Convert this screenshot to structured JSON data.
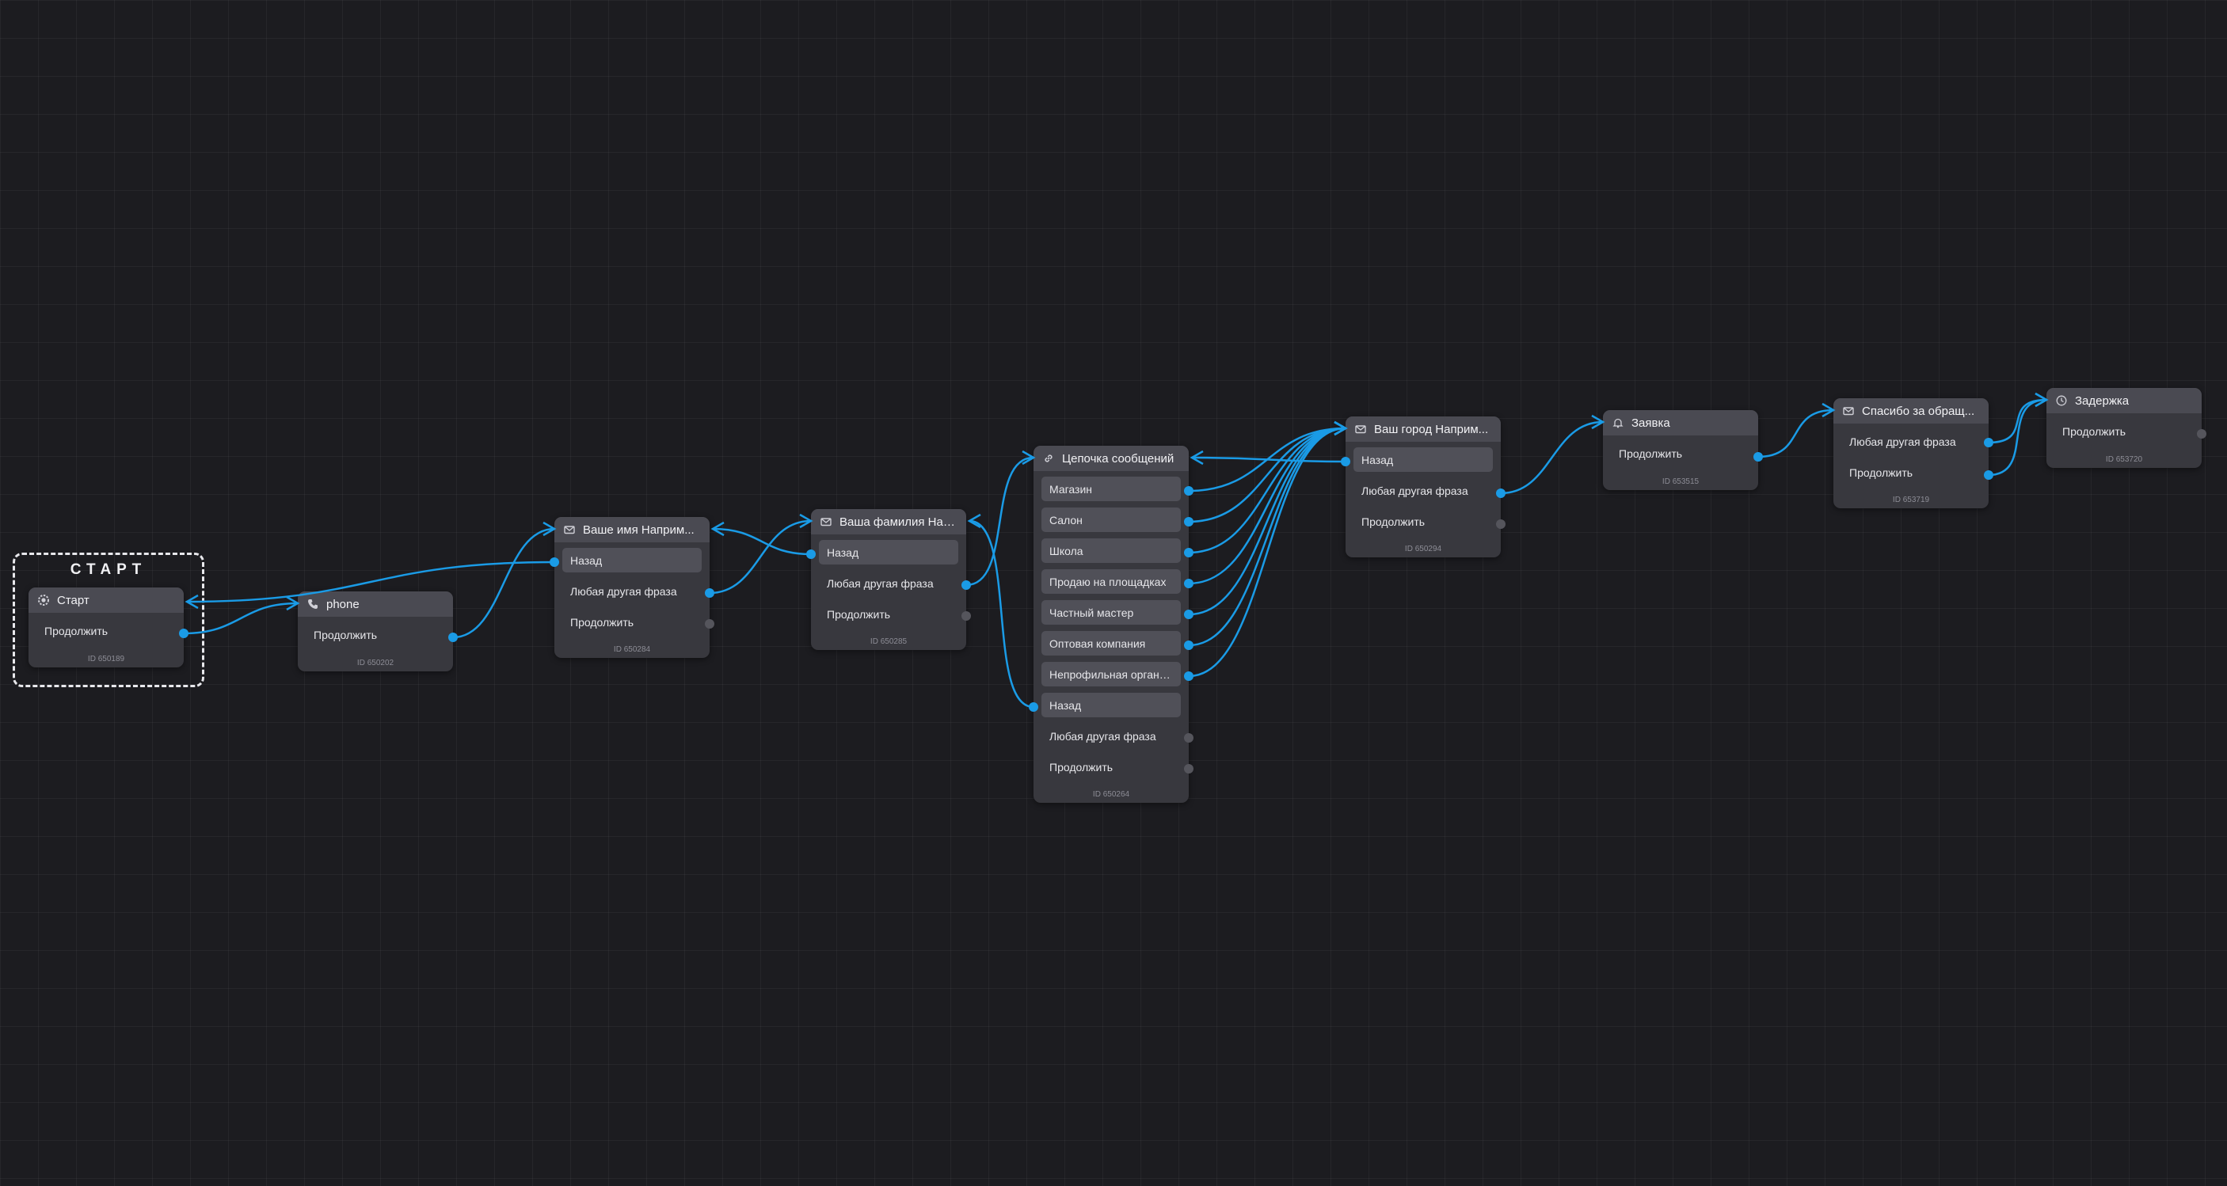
{
  "canvas": {
    "accent_color": "#1a9be6",
    "background_color": "#1c1c20",
    "inactive_port_color": "#55555c"
  },
  "start_block": {
    "label": "СТАРТ"
  },
  "nodes": {
    "start": {
      "title": "Старт",
      "icon": "gear-icon",
      "rows": [
        "Продолжить"
      ],
      "id": "ID 650189"
    },
    "phone": {
      "title": "phone",
      "icon": "phone-icon",
      "rows": [
        "Продолжить"
      ],
      "id": "ID 650202"
    },
    "name": {
      "title": "Ваше имя Наприм...",
      "icon": "envelope-icon",
      "rows": [
        "Назад",
        "Любая другая фраза",
        "Продолжить"
      ],
      "id": "ID 650284"
    },
    "surname": {
      "title": "Ваша фамилия Нап...",
      "icon": "envelope-icon",
      "rows": [
        "Назад",
        "Любая другая фраза",
        "Продолжить"
      ],
      "id": "ID 650285"
    },
    "chain": {
      "title": "Цепочка сообщений",
      "icon": "link-icon",
      "rows": [
        "Магазин",
        "Салон",
        "Школа",
        "Продаю на площадках",
        "Частный мастер",
        "Оптовая компания",
        "Непрофильная организа...",
        "Назад",
        "Любая другая фраза",
        "Продолжить"
      ],
      "id": "ID 650264"
    },
    "city": {
      "title": "Ваш город Наприм...",
      "icon": "envelope-icon",
      "rows": [
        "Назад",
        "Любая другая фраза",
        "Продолжить"
      ],
      "id": "ID 650294"
    },
    "request": {
      "title": "Заявка",
      "icon": "bell-icon",
      "rows": [
        "Продолжить"
      ],
      "id": "ID 653515"
    },
    "thanks": {
      "title": "Спасибо за обращ...",
      "icon": "envelope-icon",
      "rows": [
        "Любая другая фраза",
        "Продолжить"
      ],
      "id": "ID 653719"
    },
    "delay": {
      "title": "Задержка",
      "icon": "clock-icon",
      "rows": [
        "Продолжить"
      ],
      "id": "ID 653720"
    }
  }
}
